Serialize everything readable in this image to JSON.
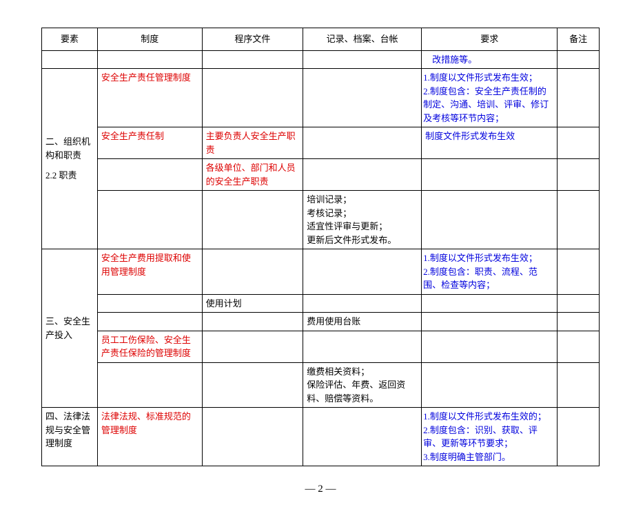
{
  "headers": {
    "c1": "要素",
    "c2": "制度",
    "c3": "程序文件",
    "c4": "记录、档案、台帐",
    "c5": "要求",
    "c6": "备注"
  },
  "rows": {
    "r0_req": "改措施等。",
    "r1_sys": "安全生产责任管理制度",
    "r1_req_line1": "1.制度以文件形式发布生效；",
    "r1_req_line2": "2.制度包含：安全生产责任制的制定、沟通、培训、评审、修订及考核等环节内容；",
    "section2_title_l1": "二、组织机构和职责",
    "section2_title_l2": "2.2 职责",
    "r2_sys": "安全生产责任制",
    "r2_proc": "主要负责人安全生产职责",
    "r2_req": "制度文件形式发布生效",
    "r3_proc": "各级单位、部门和人员的安全生产职责",
    "r4_rec_l1": "培训记录；",
    "r4_rec_l2": "考核记录；",
    "r4_rec_l3": "适宜性评审与更新；",
    "r4_rec_l4": "更新后文件形式发布。",
    "section3_title": "三、安全生产投入",
    "r5_sys": "安全生产费用提取和使用管理制度",
    "r5_req_l1": "1.制度以文件形式发布生效；",
    "r5_req_l2": "2.制度包含：职责、流程、范围、检查等内容；",
    "r6_proc": "使用计划",
    "r7_rec": "费用使用台账",
    "r8_sys": "员工工伤保险、安全生产责任保险的管理制度",
    "r9_rec_l1": "缴费相关资料；",
    "r9_rec_l2": "保险评估、年费、返回资料、赔偿等资料。",
    "section4_title": "四、法律法规与安全管理制度",
    "r10_sys": "法律法规、标准规范的管理制度",
    "r10_req_l1": "1.制度以文件形式发布生效的；",
    "r10_req_l2": "2.制度包含：识别、获取、评审、更新等环节要求；",
    "r10_req_l3": "3.制度明确主管部门。"
  },
  "pagenum": "— 2 —"
}
